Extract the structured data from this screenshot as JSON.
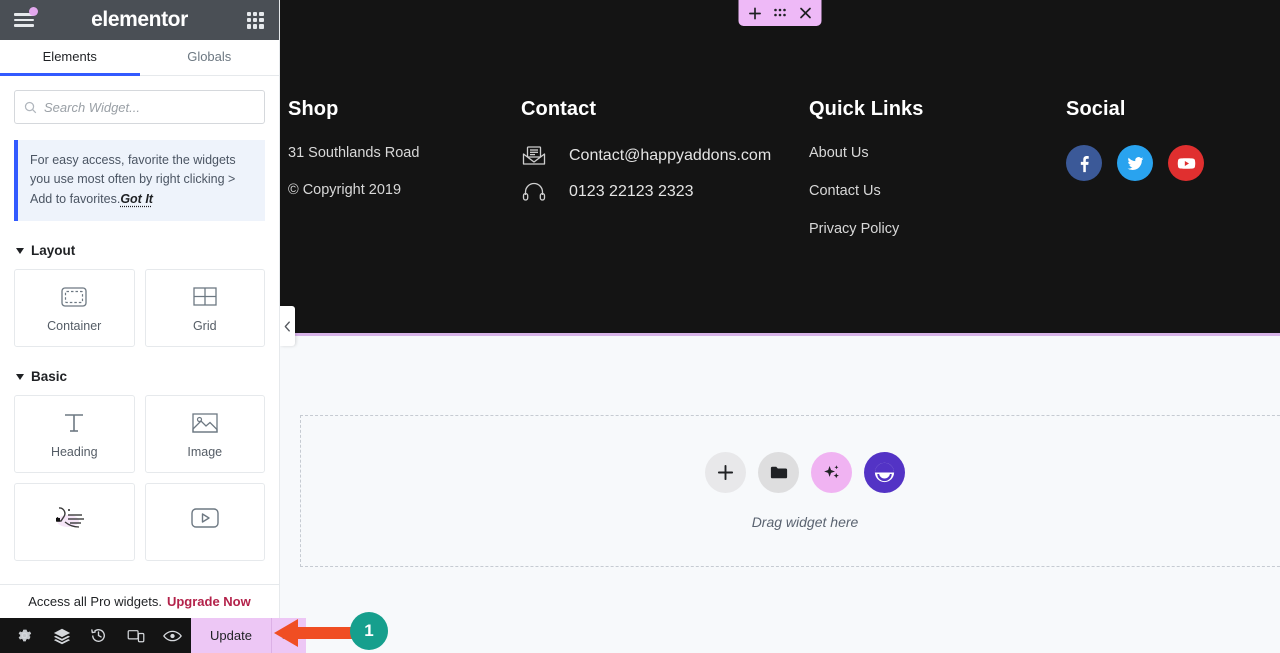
{
  "panel": {
    "brand": "elementor",
    "menu_icon": "hamburger-icon",
    "apps_icon": "apps-grid-icon",
    "tabs": [
      {
        "label": "Elements",
        "active": true
      },
      {
        "label": "Globals",
        "active": false
      }
    ],
    "search": {
      "placeholder": "Search Widget...",
      "value": "",
      "icon": "search-icon"
    },
    "tip": {
      "text": "For easy access, favorite the widgets you use most often by right clicking > Add to favorites.",
      "cta": "Got It",
      "accent": "#325AFF"
    },
    "sections": [
      {
        "title": "Layout",
        "widgets": [
          {
            "label": "Container",
            "icon": "container-icon"
          },
          {
            "label": "Grid",
            "icon": "grid-icon"
          }
        ]
      },
      {
        "title": "Basic",
        "widgets": [
          {
            "label": "Heading",
            "icon": "heading-icon"
          },
          {
            "label": "Image",
            "icon": "image-icon"
          },
          {
            "label": "",
            "icon": "text-editor-icon"
          },
          {
            "label": "",
            "icon": "video-icon"
          }
        ]
      }
    ],
    "pro_bar": {
      "text": "Access all Pro widgets.",
      "link": "Upgrade Now",
      "link_color": "#b3224a"
    },
    "bottom_bar": {
      "icons": [
        "settings-gear-icon",
        "navigator-layers-icon",
        "history-icon",
        "responsive-mode-icon",
        "preview-eye-icon"
      ],
      "update_label": "Update",
      "update_caret": "chevron-up-icon",
      "update_color": "#edc7f5"
    }
  },
  "canvas": {
    "section_toolbar": {
      "add": "plus-icon",
      "drag": "drag-handle-icon",
      "close": "close-icon",
      "color": "#eeb9f7"
    },
    "collapse_handle": "chevron-left-icon",
    "footer": {
      "background": "#141414",
      "columns": [
        {
          "title": "Shop",
          "type": "text",
          "lines": [
            "31 Southlands Road",
            "© Copyright 2019"
          ]
        },
        {
          "title": "Contact",
          "type": "contact",
          "items": [
            {
              "icon": "envelope-icon",
              "text": "Contact@happyaddons.com"
            },
            {
              "icon": "headset-icon",
              "text": "0123 22123 2323"
            }
          ]
        },
        {
          "title": "Quick Links",
          "type": "links",
          "links": [
            "About Us",
            "Contact Us",
            "Privacy Policy"
          ]
        },
        {
          "title": "Social",
          "type": "social",
          "socials": [
            {
              "name": "facebook-icon",
              "color": "#3b5998"
            },
            {
              "name": "twitter-icon",
              "color": "#29a3ef"
            },
            {
              "name": "youtube-icon",
              "color": "#e02f2f"
            }
          ]
        }
      ]
    },
    "dropzone": {
      "label": "Drag widget here",
      "buttons": [
        {
          "name": "add-widget-button",
          "icon": "plus-icon",
          "color": "#e8e8ea"
        },
        {
          "name": "add-template-button",
          "icon": "folder-icon",
          "color": "#dededf"
        },
        {
          "name": "ai-button",
          "icon": "sparkle-icon",
          "color": "#f0b3f2"
        },
        {
          "name": "happyaddons-button",
          "icon": "happy-face-icon",
          "color": "#5333c5"
        }
      ]
    }
  },
  "annotation": {
    "number": "1",
    "arrow_color": "#f04e23",
    "badge_color": "#169f8d",
    "direction": "left"
  }
}
